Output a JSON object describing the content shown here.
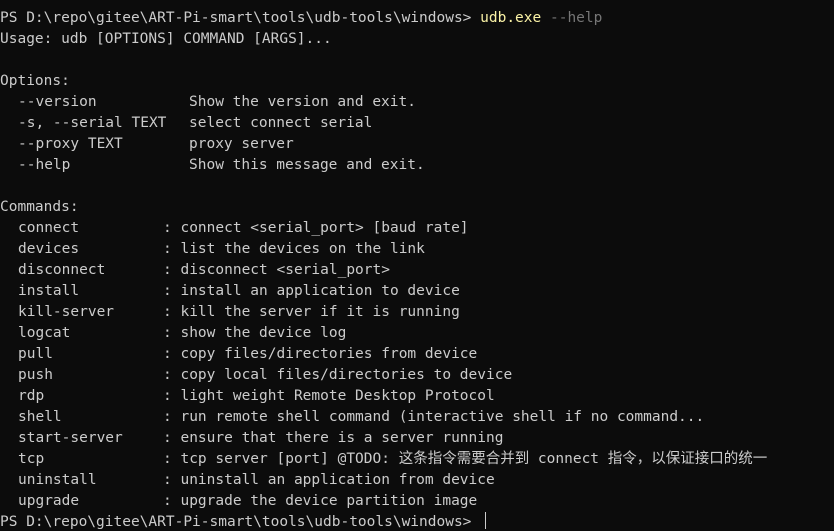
{
  "prompt": "PS D:\\repo\\gitee\\ART-Pi-smart\\tools\\udb-tools\\windows> ",
  "command": {
    "name": "udb.exe",
    "arg": "--help"
  },
  "usage": "Usage: udb [OPTIONS] COMMAND [ARGS]...",
  "options_header": "Options:",
  "options": [
    {
      "flag": "--version",
      "desc": "Show the version and exit."
    },
    {
      "flag": "-s, --serial TEXT",
      "desc": "select connect serial"
    },
    {
      "flag": "--proxy TEXT",
      "desc": "proxy server"
    },
    {
      "flag": "--help",
      "desc": "Show this message and exit."
    }
  ],
  "commands_header": "Commands:",
  "commands": [
    {
      "name": "connect",
      "desc": ": connect <serial_port> [baud rate]"
    },
    {
      "name": "devices",
      "desc": ": list the devices on the link"
    },
    {
      "name": "disconnect",
      "desc": ": disconnect <serial_port>"
    },
    {
      "name": "install",
      "desc": ": install an application to device"
    },
    {
      "name": "kill-server",
      "desc": ": kill the server if it is running"
    },
    {
      "name": "logcat",
      "desc": ": show the device log"
    },
    {
      "name": "pull",
      "desc": ": copy files/directories from device"
    },
    {
      "name": "push",
      "desc": ": copy local files/directories to device"
    },
    {
      "name": "rdp",
      "desc": ": light weight Remote Desktop Protocol"
    },
    {
      "name": "shell",
      "desc": ": run remote shell command (interactive shell if no command..."
    },
    {
      "name": "start-server",
      "desc": ": ensure that there is a server running"
    },
    {
      "name": "tcp",
      "desc": ": tcp server [port] @TODO: 这条指令需要合并到 connect 指令，以保证接口的统一"
    },
    {
      "name": "uninstall",
      "desc": ": uninstall an application from device"
    },
    {
      "name": "upgrade",
      "desc": ": upgrade the device partition image"
    }
  ],
  "prompt_end": "PS D:\\repo\\gitee\\ART-Pi-smart\\tools\\udb-tools\\windows> ",
  "colors": {
    "background": "#0c0c0c",
    "text": "#cccccc",
    "command": "#f9f1a5",
    "argument": "#767676"
  }
}
